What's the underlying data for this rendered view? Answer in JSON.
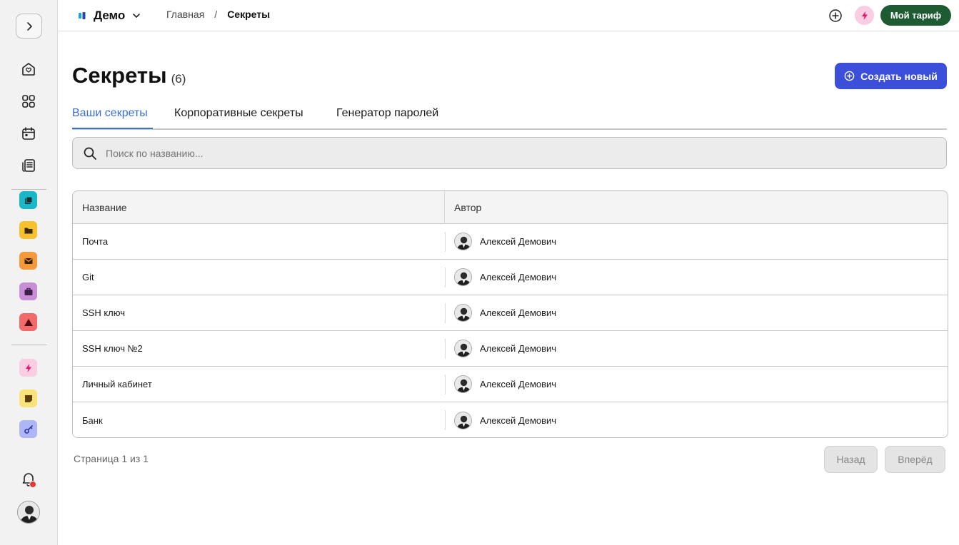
{
  "workspace": {
    "name": "Демо"
  },
  "breadcrumb": {
    "home": "Главная",
    "separator": "/",
    "current": "Секреты"
  },
  "topbar": {
    "tariff_label": "Мой тариф"
  },
  "page": {
    "title": "Секреты",
    "count": "(6)",
    "create_label": "Создать новый"
  },
  "tabs": [
    {
      "label": "Ваши секреты",
      "active": true
    },
    {
      "label": "Корпоративные секреты",
      "active": false
    },
    {
      "label": "Генератор паролей",
      "active": false
    }
  ],
  "search": {
    "placeholder": "Поиск по названию..."
  },
  "table": {
    "columns": [
      "Название",
      "Автор"
    ],
    "rows": [
      {
        "name": "Почта",
        "author": "Алексей Демович"
      },
      {
        "name": "Git",
        "author": "Алексей Демович"
      },
      {
        "name": "SSH ключ",
        "author": "Алексей Демович"
      },
      {
        "name": "SSH ключ №2",
        "author": "Алексей Демович"
      },
      {
        "name": "Личный кабинет",
        "author": "Алексей Демович"
      },
      {
        "name": "Банк",
        "author": "Алексей Демович"
      }
    ]
  },
  "pagination": {
    "text": "Страница 1 из 1",
    "prev_label": "Назад",
    "next_label": "Вперёд"
  },
  "sidebar": {
    "nav_icons": [
      "home-icon",
      "apps-grid-icon",
      "calendar-icon",
      "documents-icon"
    ],
    "apps": [
      {
        "icon": "cards-app-icon",
        "color": "#19b8c9"
      },
      {
        "icon": "folder-app-icon",
        "color": "#f6c12f"
      },
      {
        "icon": "mail-app-icon",
        "color": "#f59a3b"
      },
      {
        "icon": "briefcase-app-icon",
        "color": "#c78fd6"
      },
      {
        "icon": "alert-app-icon",
        "color": "#f26a6a"
      }
    ],
    "tools": [
      {
        "icon": "bolt-app-icon",
        "color": "#f9cde2"
      },
      {
        "icon": "sticky-note-app-icon",
        "color": "#f9e27a"
      },
      {
        "icon": "key-app-icon",
        "color": "#aeb6f5"
      }
    ]
  },
  "colors": {
    "accent": "#3b4fd8",
    "tab_active": "#3b6fd8",
    "tariff": "#1d5b32",
    "notification": "#e53935"
  }
}
